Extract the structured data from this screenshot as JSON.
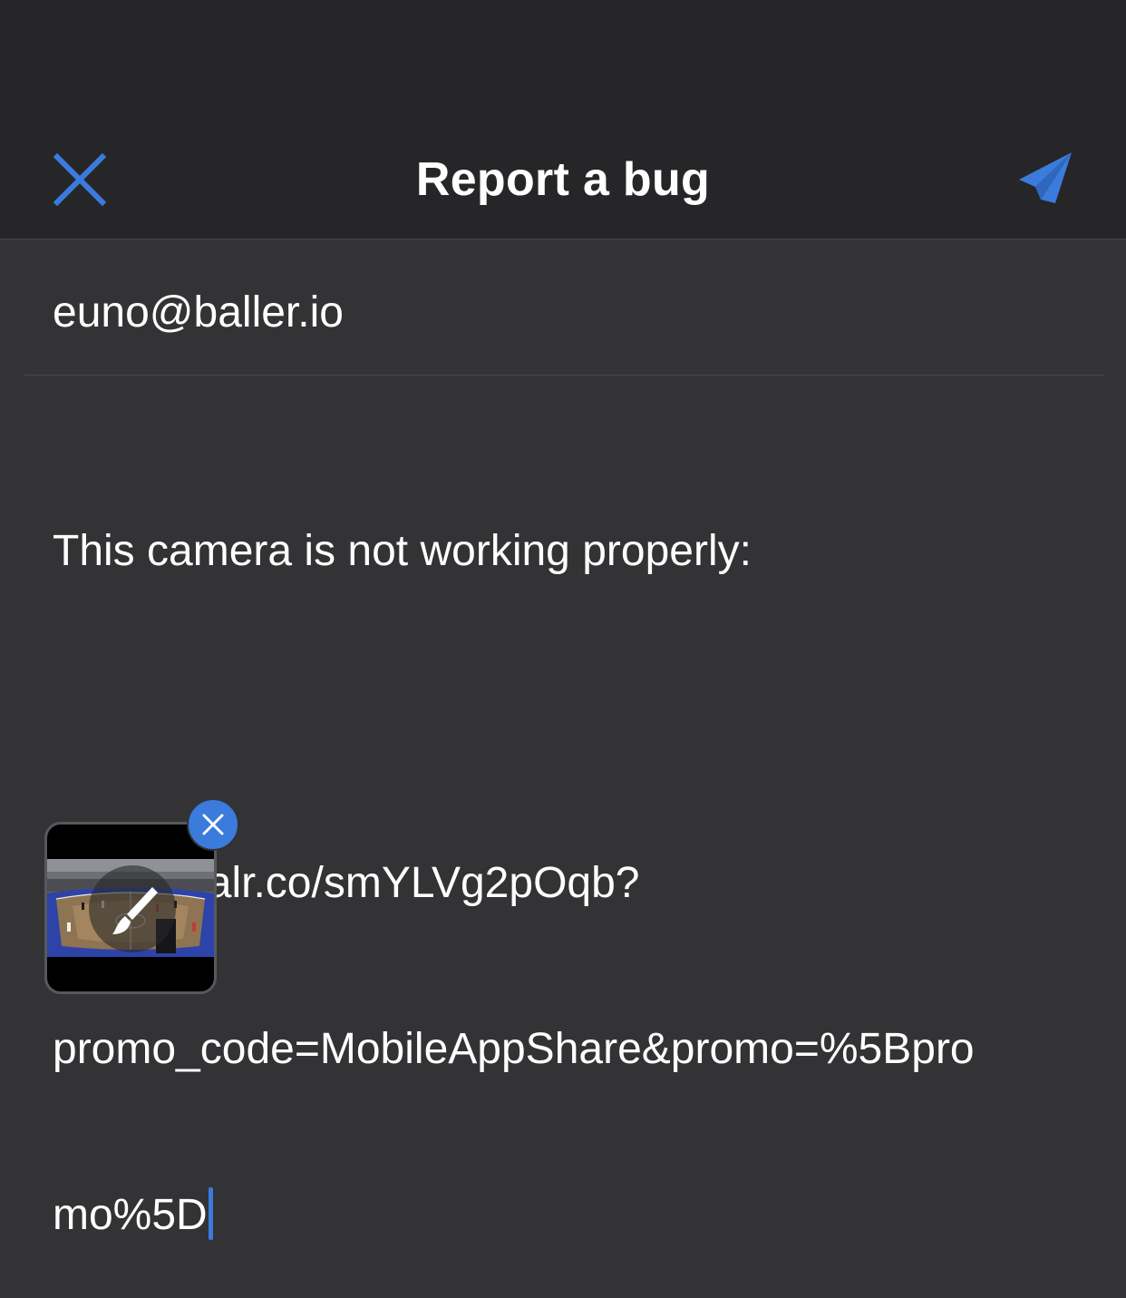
{
  "nav": {
    "title": "Report a bug",
    "close_icon": "close-x-icon",
    "send_icon": "paper-plane-icon",
    "accent_color": "#3a7bdc"
  },
  "form": {
    "email": "euno@baller.io",
    "description_lines": [
      "This camera is not working properly:",
      "",
      "https://balr.co/smYLVg2pOqb?",
      "promo_code=MobileAppShare&promo=%5Bpro",
      "mo%5D"
    ]
  },
  "attachment": {
    "annotate_icon": "paintbrush-icon",
    "remove_icon": "close-x-icon"
  }
}
